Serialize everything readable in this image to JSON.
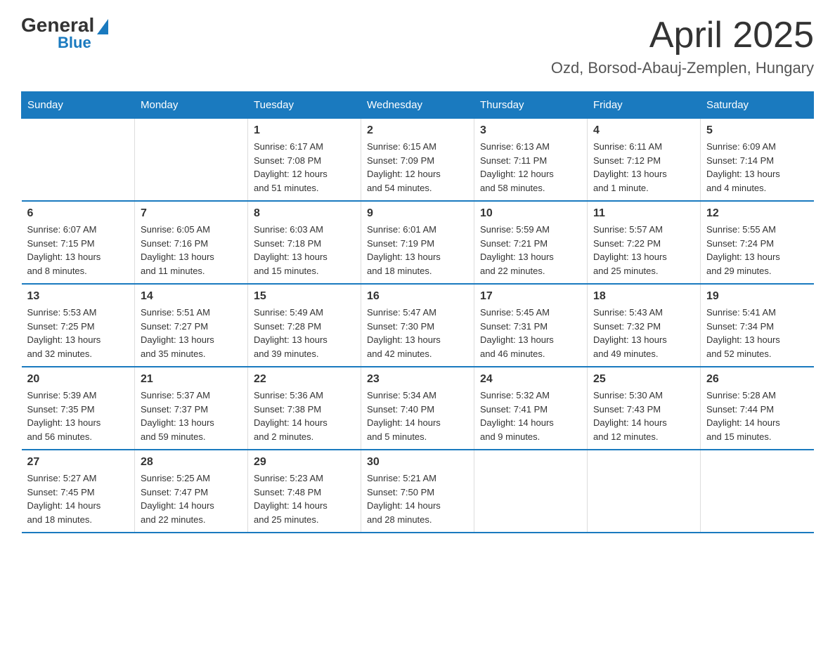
{
  "logo": {
    "general": "General",
    "blue": "Blue"
  },
  "title": {
    "month": "April 2025",
    "location": "Ozd, Borsod-Abauj-Zemplen, Hungary"
  },
  "days_header": [
    "Sunday",
    "Monday",
    "Tuesday",
    "Wednesday",
    "Thursday",
    "Friday",
    "Saturday"
  ],
  "weeks": [
    [
      {
        "day": "",
        "info": ""
      },
      {
        "day": "",
        "info": ""
      },
      {
        "day": "1",
        "info": "Sunrise: 6:17 AM\nSunset: 7:08 PM\nDaylight: 12 hours\nand 51 minutes."
      },
      {
        "day": "2",
        "info": "Sunrise: 6:15 AM\nSunset: 7:09 PM\nDaylight: 12 hours\nand 54 minutes."
      },
      {
        "day": "3",
        "info": "Sunrise: 6:13 AM\nSunset: 7:11 PM\nDaylight: 12 hours\nand 58 minutes."
      },
      {
        "day": "4",
        "info": "Sunrise: 6:11 AM\nSunset: 7:12 PM\nDaylight: 13 hours\nand 1 minute."
      },
      {
        "day": "5",
        "info": "Sunrise: 6:09 AM\nSunset: 7:14 PM\nDaylight: 13 hours\nand 4 minutes."
      }
    ],
    [
      {
        "day": "6",
        "info": "Sunrise: 6:07 AM\nSunset: 7:15 PM\nDaylight: 13 hours\nand 8 minutes."
      },
      {
        "day": "7",
        "info": "Sunrise: 6:05 AM\nSunset: 7:16 PM\nDaylight: 13 hours\nand 11 minutes."
      },
      {
        "day": "8",
        "info": "Sunrise: 6:03 AM\nSunset: 7:18 PM\nDaylight: 13 hours\nand 15 minutes."
      },
      {
        "day": "9",
        "info": "Sunrise: 6:01 AM\nSunset: 7:19 PM\nDaylight: 13 hours\nand 18 minutes."
      },
      {
        "day": "10",
        "info": "Sunrise: 5:59 AM\nSunset: 7:21 PM\nDaylight: 13 hours\nand 22 minutes."
      },
      {
        "day": "11",
        "info": "Sunrise: 5:57 AM\nSunset: 7:22 PM\nDaylight: 13 hours\nand 25 minutes."
      },
      {
        "day": "12",
        "info": "Sunrise: 5:55 AM\nSunset: 7:24 PM\nDaylight: 13 hours\nand 29 minutes."
      }
    ],
    [
      {
        "day": "13",
        "info": "Sunrise: 5:53 AM\nSunset: 7:25 PM\nDaylight: 13 hours\nand 32 minutes."
      },
      {
        "day": "14",
        "info": "Sunrise: 5:51 AM\nSunset: 7:27 PM\nDaylight: 13 hours\nand 35 minutes."
      },
      {
        "day": "15",
        "info": "Sunrise: 5:49 AM\nSunset: 7:28 PM\nDaylight: 13 hours\nand 39 minutes."
      },
      {
        "day": "16",
        "info": "Sunrise: 5:47 AM\nSunset: 7:30 PM\nDaylight: 13 hours\nand 42 minutes."
      },
      {
        "day": "17",
        "info": "Sunrise: 5:45 AM\nSunset: 7:31 PM\nDaylight: 13 hours\nand 46 minutes."
      },
      {
        "day": "18",
        "info": "Sunrise: 5:43 AM\nSunset: 7:32 PM\nDaylight: 13 hours\nand 49 minutes."
      },
      {
        "day": "19",
        "info": "Sunrise: 5:41 AM\nSunset: 7:34 PM\nDaylight: 13 hours\nand 52 minutes."
      }
    ],
    [
      {
        "day": "20",
        "info": "Sunrise: 5:39 AM\nSunset: 7:35 PM\nDaylight: 13 hours\nand 56 minutes."
      },
      {
        "day": "21",
        "info": "Sunrise: 5:37 AM\nSunset: 7:37 PM\nDaylight: 13 hours\nand 59 minutes."
      },
      {
        "day": "22",
        "info": "Sunrise: 5:36 AM\nSunset: 7:38 PM\nDaylight: 14 hours\nand 2 minutes."
      },
      {
        "day": "23",
        "info": "Sunrise: 5:34 AM\nSunset: 7:40 PM\nDaylight: 14 hours\nand 5 minutes."
      },
      {
        "day": "24",
        "info": "Sunrise: 5:32 AM\nSunset: 7:41 PM\nDaylight: 14 hours\nand 9 minutes."
      },
      {
        "day": "25",
        "info": "Sunrise: 5:30 AM\nSunset: 7:43 PM\nDaylight: 14 hours\nand 12 minutes."
      },
      {
        "day": "26",
        "info": "Sunrise: 5:28 AM\nSunset: 7:44 PM\nDaylight: 14 hours\nand 15 minutes."
      }
    ],
    [
      {
        "day": "27",
        "info": "Sunrise: 5:27 AM\nSunset: 7:45 PM\nDaylight: 14 hours\nand 18 minutes."
      },
      {
        "day": "28",
        "info": "Sunrise: 5:25 AM\nSunset: 7:47 PM\nDaylight: 14 hours\nand 22 minutes."
      },
      {
        "day": "29",
        "info": "Sunrise: 5:23 AM\nSunset: 7:48 PM\nDaylight: 14 hours\nand 25 minutes."
      },
      {
        "day": "30",
        "info": "Sunrise: 5:21 AM\nSunset: 7:50 PM\nDaylight: 14 hours\nand 28 minutes."
      },
      {
        "day": "",
        "info": ""
      },
      {
        "day": "",
        "info": ""
      },
      {
        "day": "",
        "info": ""
      }
    ]
  ]
}
